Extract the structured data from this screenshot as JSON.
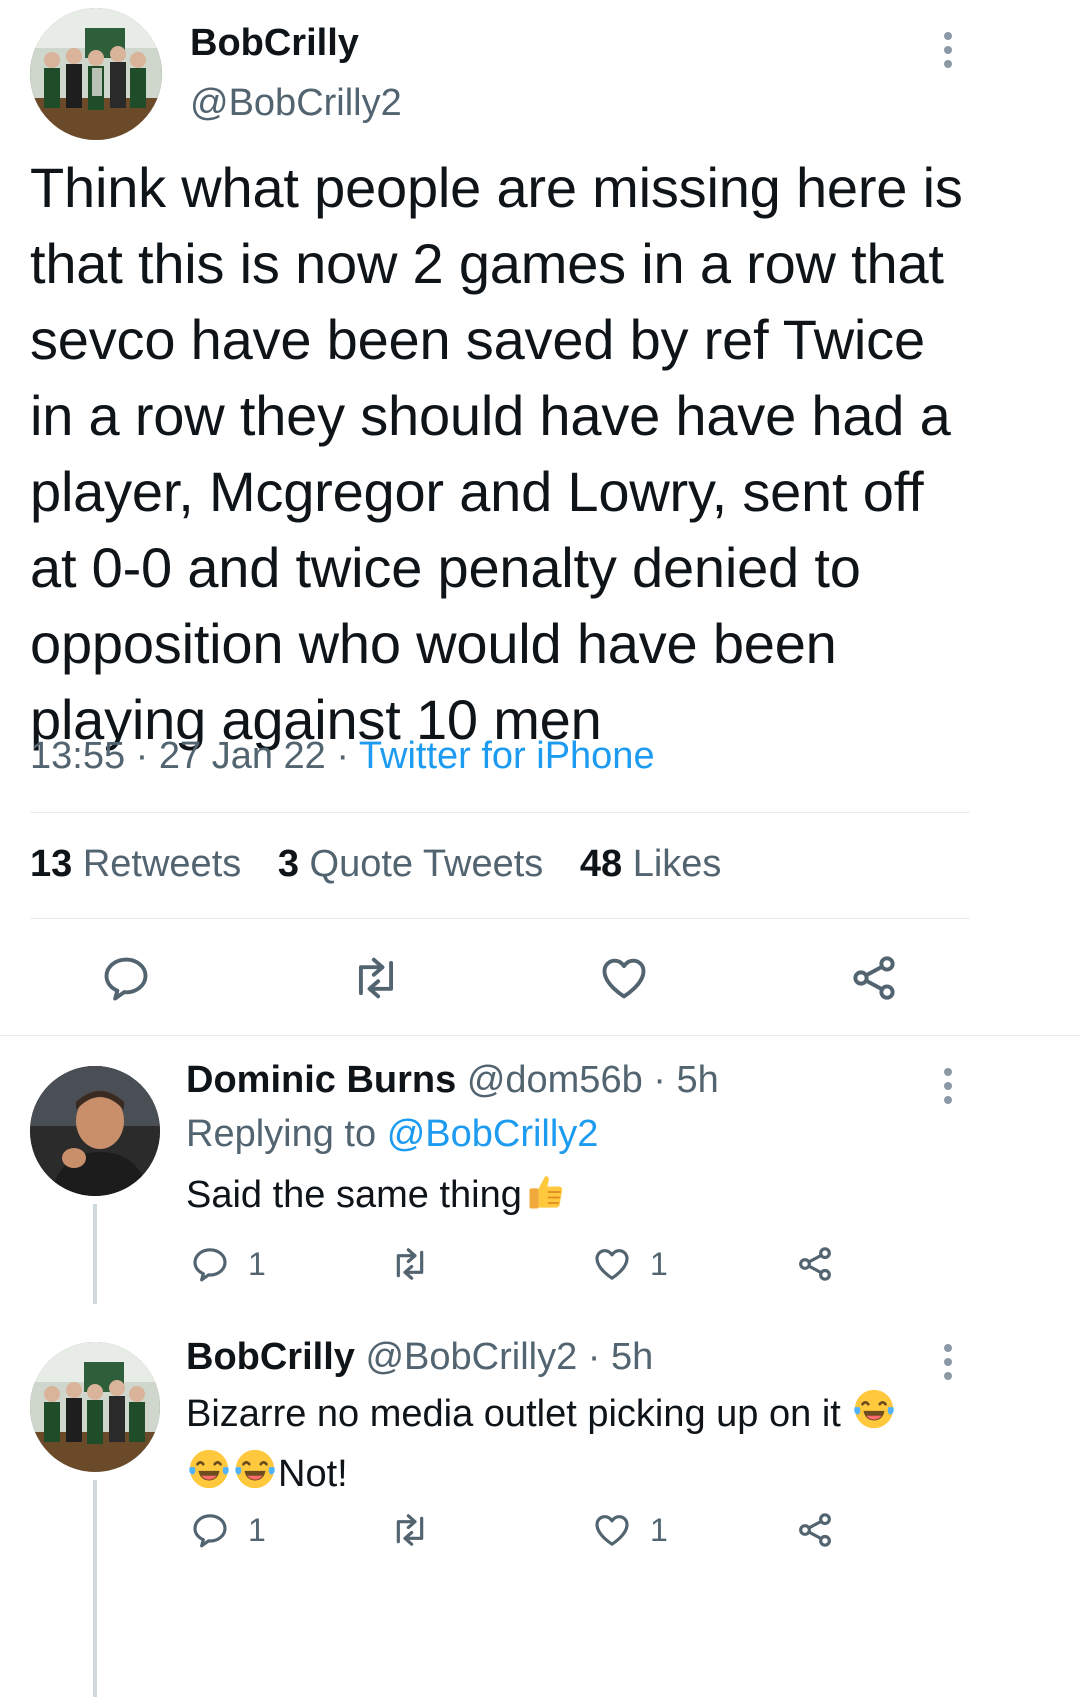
{
  "tweet": {
    "display_name": "BobCrilly",
    "handle": "@BobCrilly2",
    "text": "Think what people are missing here is that this is now 2 games in a row that sevco have been saved by ref Twice in a row they should have have had a player, Mcgregor and Lowry, sent off at 0-0 and twice penalty denied to opposition who would have been playing against 10 men",
    "time": "13:55",
    "separator": "·",
    "date": "27 Jan 22",
    "source": "Twitter for iPhone",
    "stats": {
      "retweets_count": "13",
      "retweets_label": "Retweets",
      "quotes_count": "3",
      "quotes_label": "Quote Tweets",
      "likes_count": "48",
      "likes_label": "Likes"
    }
  },
  "replies": [
    {
      "display_name": "Dominic Burns",
      "handle": "@dom56b",
      "separator": "·",
      "age": "5h",
      "replying_prefix": "Replying to",
      "replying_handle": "@BobCrilly2",
      "text": "Said the same thing",
      "emoji": "thumbs-up",
      "reply_count": "1",
      "like_count": "1"
    },
    {
      "display_name": "BobCrilly",
      "handle": "@BobCrilly2",
      "separator": "·",
      "age": "5h",
      "text_line1": "Bizarre no media outlet picking up on it",
      "text_line2_suffix": "Not!",
      "emoji": "face-with-tears-of-joy",
      "reply_count": "1",
      "like_count": "1"
    }
  ],
  "colors": {
    "text": "#0f1419",
    "secondary": "#536471",
    "accent": "#1d9bf0",
    "divider": "#e6ecf0"
  }
}
